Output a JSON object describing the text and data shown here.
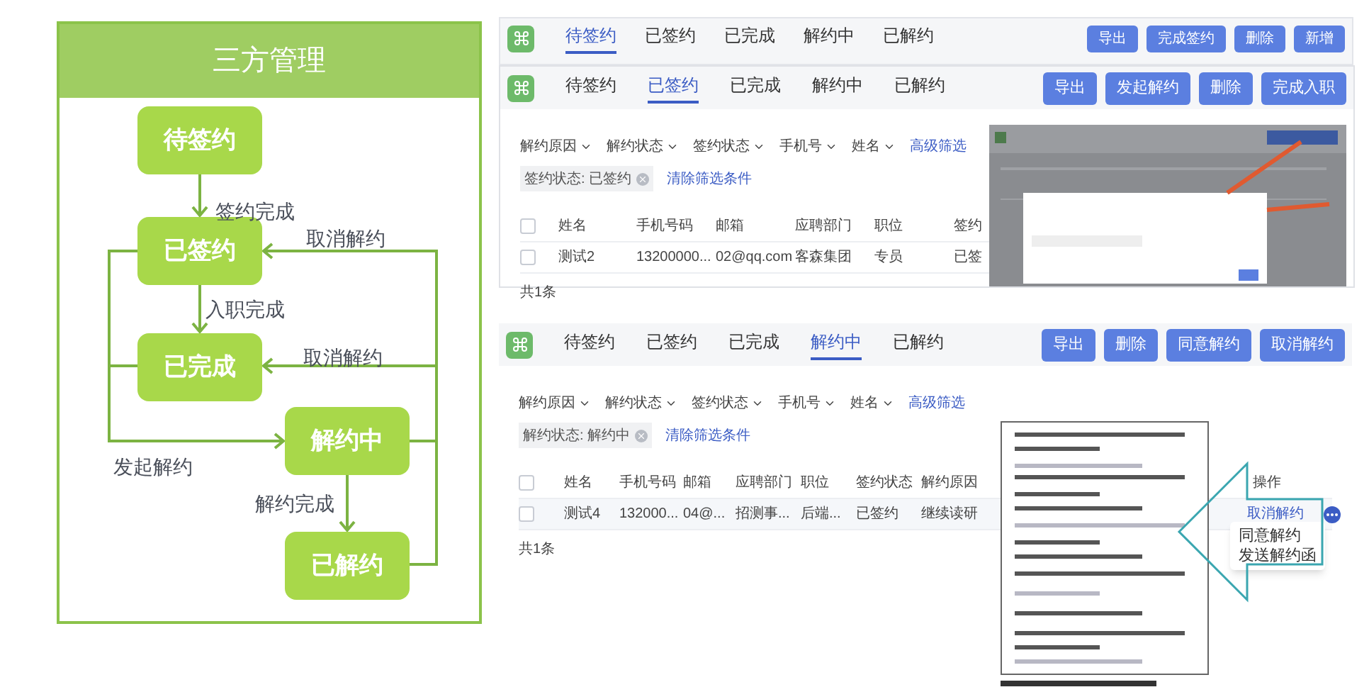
{
  "diagram": {
    "title": "三方管理",
    "nodes": [
      {
        "label": "待签约"
      },
      {
        "label": "已签约"
      },
      {
        "label": "已完成"
      },
      {
        "label": "解约中"
      },
      {
        "label": "已解约"
      }
    ],
    "edge_labels": [
      "签约完成",
      "取消解约",
      "入职完成",
      "取消解约",
      "发起解约",
      "解约完成"
    ]
  },
  "screens": [
    {
      "tabs": [
        {
          "label": "待签约",
          "selected": true
        },
        {
          "label": "已签约",
          "selected": false
        },
        {
          "label": "已完成",
          "selected": false
        },
        {
          "label": "解约中",
          "selected": false
        },
        {
          "label": "已解约",
          "selected": false
        }
      ],
      "buttons": [
        "导出",
        "完成签约",
        "删除",
        "新增"
      ]
    },
    {
      "tabs": [
        {
          "label": "待签约",
          "selected": false
        },
        {
          "label": "已签约",
          "selected": true
        },
        {
          "label": "已完成",
          "selected": false
        },
        {
          "label": "解约中",
          "selected": false
        },
        {
          "label": "已解约",
          "selected": false
        }
      ],
      "buttons": [
        "导出",
        "发起解约",
        "删除",
        "完成入职"
      ],
      "filters": [
        "解约原因",
        "解约状态",
        "签约状态",
        "手机号",
        "姓名"
      ],
      "advanced_filter": "高级筛选",
      "chip": "签约状态: 已签约",
      "clear_filters": "清除筛选条件",
      "columns": [
        "姓名",
        "手机号码",
        "邮箱",
        "应聘部门",
        "职位",
        "签约"
      ],
      "select_all": {
        "checked": false
      },
      "rows": [
        {
          "checked": false,
          "cells": [
            "测试2",
            "13200000...",
            "02@qq.com",
            "客森集团",
            "专员",
            "已签"
          ]
        }
      ],
      "footer": "共1条"
    },
    {
      "tabs": [
        {
          "label": "待签约",
          "selected": false
        },
        {
          "label": "已签约",
          "selected": false
        },
        {
          "label": "已完成",
          "selected": false
        },
        {
          "label": "解约中",
          "selected": true
        },
        {
          "label": "已解约",
          "selected": false
        }
      ],
      "buttons": [
        "导出",
        "删除",
        "同意解约",
        "取消解约"
      ],
      "filters": [
        "解约原因",
        "解约状态",
        "签约状态",
        "手机号",
        "姓名"
      ],
      "advanced_filter": "高级筛选",
      "chip": "解约状态: 解约中",
      "clear_filters": "清除筛选条件",
      "columns": [
        "姓名",
        "手机号码",
        "邮箱",
        "应聘部门",
        "职位",
        "签约状态",
        "解约原因"
      ],
      "action_column": "操作",
      "select_all": {
        "checked": false
      },
      "rows": [
        {
          "checked": false,
          "cells": [
            "测试4",
            "132000...",
            "04@...",
            "招测事...",
            "后端...",
            "已签约",
            "继续读研"
          ],
          "action": "取消解约"
        }
      ],
      "menu": [
        "同意解约",
        "发送解约函"
      ],
      "footer": "共1条"
    }
  ]
}
